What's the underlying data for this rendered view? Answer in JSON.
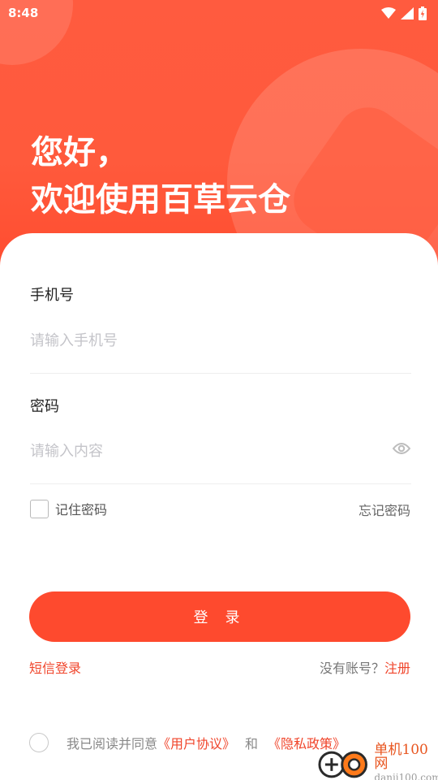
{
  "status_bar": {
    "time": "8:48"
  },
  "greeting": {
    "line1": "您好，",
    "line2": "欢迎使用百草云仓"
  },
  "phone": {
    "label": "手机号",
    "placeholder": "请输入手机号"
  },
  "password": {
    "label": "密码",
    "placeholder": "请输入内容"
  },
  "remember_label": "记住密码",
  "forgot_label": "忘记密码",
  "login_button": "登 录",
  "sms_login": "短信登录",
  "register": {
    "prompt": "没有账号？",
    "link": "注册"
  },
  "agreement": {
    "prefix": "我已阅读并同意",
    "user_agreement": "《用户协议》",
    "and": "和",
    "privacy_policy": "《隐私政策》"
  },
  "watermark": {
    "title": "单机100网",
    "url": "danji100.com"
  },
  "colors": {
    "brand": "#fe4a2e",
    "link": "#f0452b"
  },
  "icons": [
    "wifi-icon",
    "signal-icon",
    "battery-icon",
    "eye-icon"
  ]
}
